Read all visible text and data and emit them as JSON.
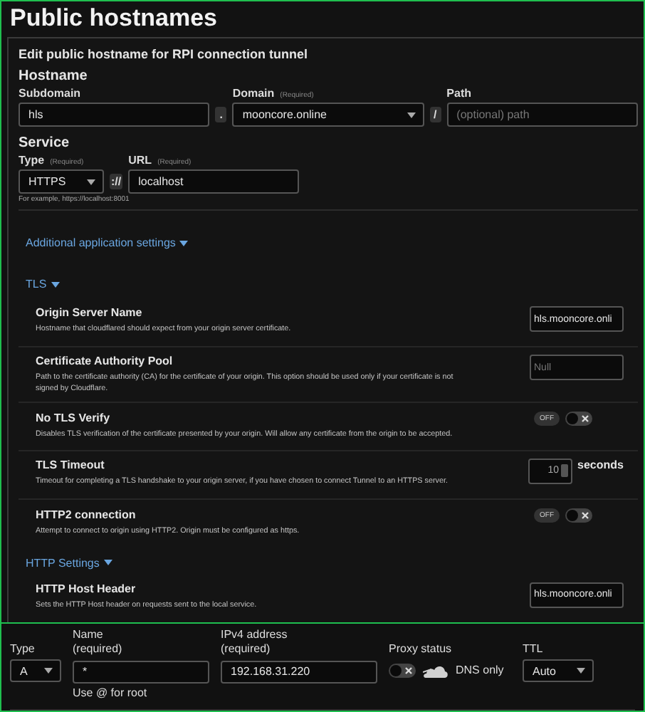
{
  "page_title": "Public hostnames",
  "form": {
    "title": "Edit public hostname for RPI connection tunnel",
    "hostname": {
      "heading": "Hostname",
      "subdomain": {
        "label": "Subdomain",
        "value": "hls"
      },
      "dot": ".",
      "domain": {
        "label": "Domain",
        "required": "(Required)",
        "value": "mooncore.online"
      },
      "slash": "/",
      "path": {
        "label": "Path",
        "placeholder": "(optional) path"
      }
    },
    "service": {
      "heading": "Service",
      "type": {
        "label": "Type",
        "required": "(Required)",
        "value": "HTTPS"
      },
      "scheme_separator": "://",
      "url": {
        "label": "URL",
        "required": "(Required)",
        "value": "localhost"
      },
      "hint": "For example, https://localhost:8001"
    },
    "additional_settings": {
      "label": "Additional application settings",
      "expanded": true
    },
    "sections": [
      {
        "label": "TLS",
        "expanded": true,
        "settings": [
          {
            "kind": "text",
            "name": "Origin Server Name",
            "description": "Hostname that cloudflared should expect from your origin server certificate.",
            "value": "hls.mooncore.onli"
          },
          {
            "kind": "text",
            "name": "Certificate Authority Pool",
            "description": "Path to the certificate authority (CA) for the certificate of your origin. This option should be used only if your certificate is not signed by Cloudflare.",
            "placeholder": "Null"
          },
          {
            "kind": "toggle",
            "name": "No TLS Verify",
            "description": "Disables TLS verification of the certificate presented by your origin. Will allow any certificate from the origin to be accepted.",
            "state_label": "OFF",
            "on": false
          },
          {
            "kind": "number",
            "name": "TLS Timeout",
            "description": "Timeout for completing a TLS handshake to your origin server, if you have chosen to connect Tunnel to an HTTPS server.",
            "value": "10",
            "unit": "seconds"
          },
          {
            "kind": "toggle",
            "name": "HTTP2 connection",
            "description": "Attempt to connect to origin using HTTP2. Origin must be configured as https.",
            "state_label": "OFF",
            "on": false
          }
        ]
      },
      {
        "label": "HTTP Settings",
        "expanded": true,
        "settings": [
          {
            "kind": "text",
            "name": "HTTP Host Header",
            "description": "Sets the HTTP Host header on requests sent to the local service.",
            "value": "hls.mooncore.onli"
          }
        ]
      }
    ]
  },
  "dns_record": {
    "type": {
      "label": "Type",
      "value": "A"
    },
    "name": {
      "label": "Name",
      "required": "(required)",
      "value": "*",
      "hint": "Use @ for root"
    },
    "ipv4": {
      "label": "IPv4 address",
      "required": "(required)",
      "value": "192.168.31.220"
    },
    "proxy": {
      "label": "Proxy status",
      "on": false,
      "status": "DNS only"
    },
    "ttl": {
      "label": "TTL",
      "value": "Auto"
    }
  }
}
